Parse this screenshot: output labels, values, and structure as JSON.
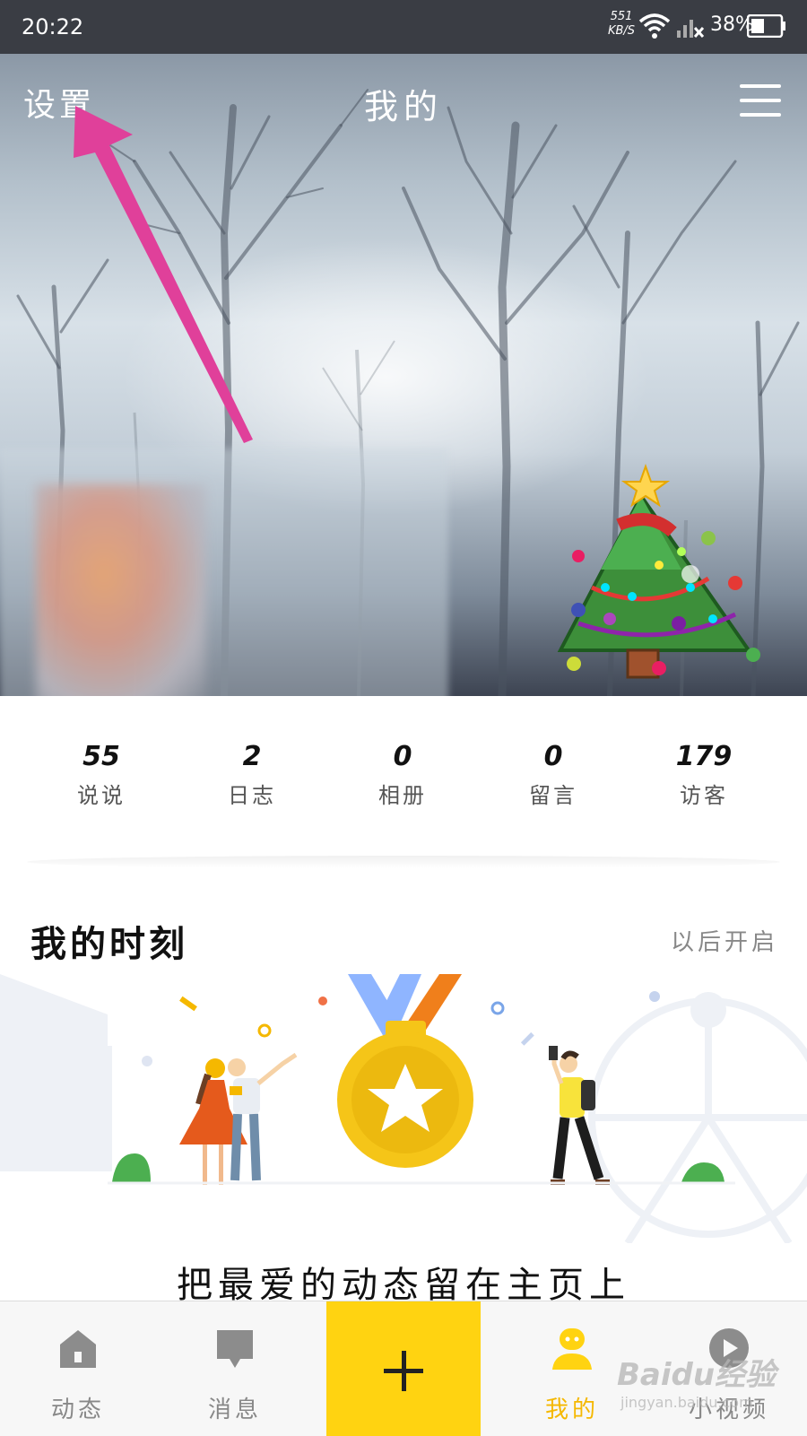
{
  "status_bar": {
    "time": "20:22",
    "net_speed": "551",
    "net_unit": "KB/S",
    "battery": "38%"
  },
  "header": {
    "settings_label": "设置",
    "title": "我的",
    "menu_icon": "hamburger-menu-icon"
  },
  "stats": [
    {
      "value": "55",
      "label": "说说"
    },
    {
      "value": "2",
      "label": "日志"
    },
    {
      "value": "0",
      "label": "相册"
    },
    {
      "value": "0",
      "label": "留言"
    },
    {
      "value": "179",
      "label": "访客"
    }
  ],
  "moments": {
    "title": "我的时刻",
    "action": "以后开启",
    "caption": "把最爱的动态留在主页上"
  },
  "bottom_nav": [
    {
      "label": "动态",
      "icon": "home-icon"
    },
    {
      "label": "消息",
      "icon": "message-icon"
    },
    {
      "label": "",
      "icon": "plus-icon"
    },
    {
      "label": "我的",
      "icon": "profile-icon",
      "active": true
    },
    {
      "label": "小视频",
      "icon": "play-icon"
    }
  ],
  "watermark": {
    "logo": "Baidu经验",
    "url": "jingyan.baidu.com"
  },
  "colors": {
    "accent_yellow": "#ffd311",
    "active_label": "#f5b800",
    "annotation_arrow": "#e0409a"
  }
}
